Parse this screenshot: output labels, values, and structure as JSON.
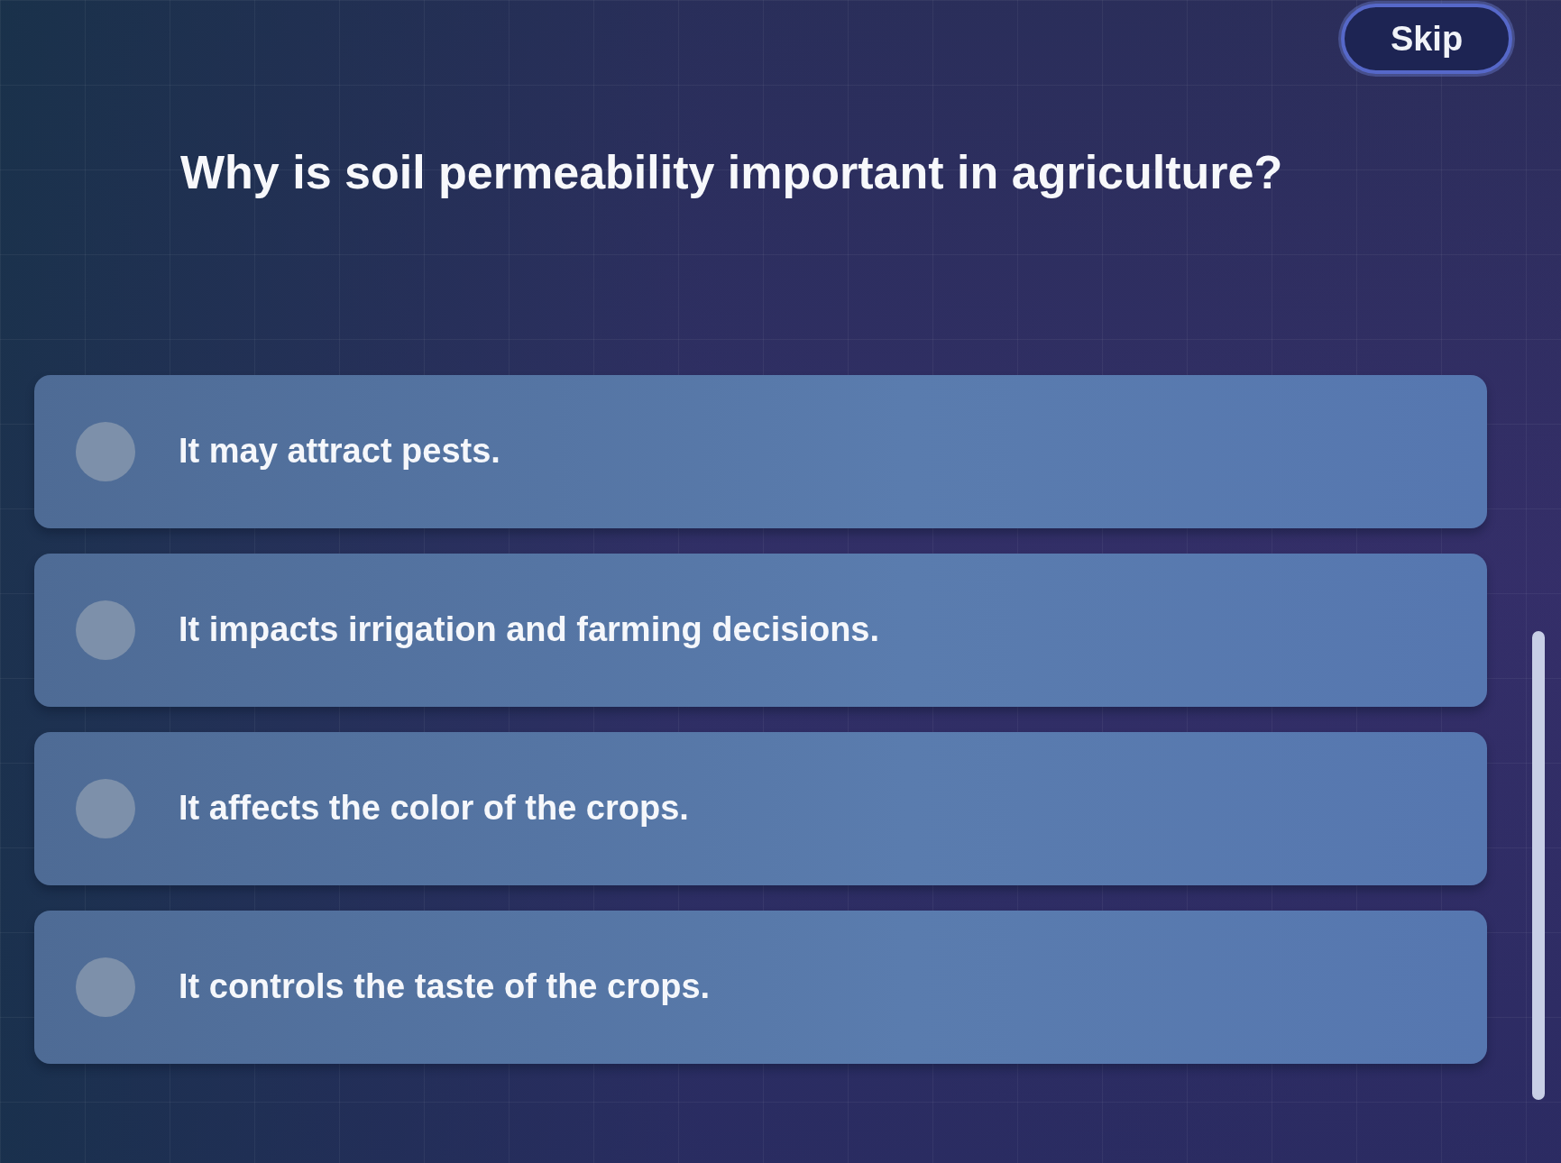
{
  "skip_button": {
    "label": "Skip"
  },
  "question": "Why is soil permeability important in agriculture?",
  "options": [
    {
      "text": "It may attract pests.",
      "selected": false
    },
    {
      "text": "It impacts irrigation and farming decisions.",
      "selected": false
    },
    {
      "text": "It affects the color of the crops.",
      "selected": false
    },
    {
      "text": "It controls the taste of the crops.",
      "selected": false
    }
  ]
}
